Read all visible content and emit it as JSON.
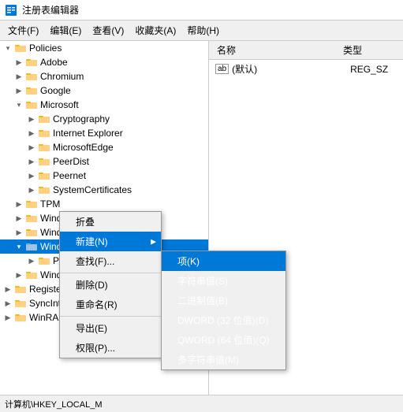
{
  "titleBar": {
    "icon": "registry-editor-icon",
    "title": "注册表编辑器"
  },
  "menuBar": {
    "items": [
      {
        "label": "文件(F)"
      },
      {
        "label": "编辑(E)"
      },
      {
        "label": "查看(V)"
      },
      {
        "label": "收藏夹(A)"
      },
      {
        "label": "帮助(H)"
      }
    ]
  },
  "tree": {
    "items": [
      {
        "id": "policies",
        "label": "Policies",
        "indent": 0,
        "expanded": true,
        "selected": false
      },
      {
        "id": "adobe",
        "label": "Adobe",
        "indent": 1,
        "expanded": false,
        "selected": false
      },
      {
        "id": "chromium",
        "label": "Chromium",
        "indent": 1,
        "expanded": false,
        "selected": false
      },
      {
        "id": "google",
        "label": "Google",
        "indent": 1,
        "expanded": false,
        "selected": false
      },
      {
        "id": "microsoft",
        "label": "Microsoft",
        "indent": 1,
        "expanded": true,
        "selected": false
      },
      {
        "id": "cryptography",
        "label": "Cryptography",
        "indent": 2,
        "expanded": false,
        "selected": false
      },
      {
        "id": "internet-explorer",
        "label": "Internet Explorer",
        "indent": 2,
        "expanded": false,
        "selected": false
      },
      {
        "id": "microsoftedge",
        "label": "MicrosoftEdge",
        "indent": 2,
        "expanded": false,
        "selected": false
      },
      {
        "id": "peerdist",
        "label": "PeerDist",
        "indent": 2,
        "expanded": false,
        "selected": false
      },
      {
        "id": "peernet",
        "label": "Peernet",
        "indent": 2,
        "expanded": false,
        "selected": false
      },
      {
        "id": "systemcertificates",
        "label": "SystemCertificates",
        "indent": 2,
        "expanded": false,
        "selected": false
      },
      {
        "id": "tpm",
        "label": "TPM",
        "indent": 1,
        "expanded": false,
        "selected": false
      },
      {
        "id": "windows",
        "label": "Windows",
        "indent": 1,
        "expanded": false,
        "selected": false
      },
      {
        "id": "windows-advanced-thre",
        "label": "Windows Advanced Thre",
        "indent": 1,
        "expanded": false,
        "selected": false
      },
      {
        "id": "windows-defender",
        "label": "Windows Defender",
        "indent": 1,
        "expanded": true,
        "selected": true
      },
      {
        "id": "polic",
        "label": "Polic",
        "indent": 2,
        "expanded": false,
        "selected": false
      },
      {
        "id": "windowo",
        "label": "Windowo",
        "indent": 1,
        "expanded": false,
        "selected": false
      },
      {
        "id": "registeredap",
        "label": "RegisteredAp",
        "indent": 0,
        "expanded": false,
        "selected": false
      },
      {
        "id": "syncintegratic",
        "label": "SyncIntegratic",
        "indent": 0,
        "expanded": false,
        "selected": false
      },
      {
        "id": "winrar",
        "label": "WinRAR",
        "indent": 0,
        "expanded": false,
        "selected": false
      }
    ]
  },
  "rightPane": {
    "columns": [
      {
        "label": "名称"
      },
      {
        "label": "类型"
      }
    ],
    "entries": [
      {
        "icon": "ab",
        "name": "(默认)",
        "type": "REG_SZ"
      }
    ]
  },
  "contextMenu": {
    "items": [
      {
        "label": "折叠",
        "id": "collapse",
        "hasSubmenu": false
      },
      {
        "label": "新建(N)",
        "id": "new",
        "hasSubmenu": true,
        "highlighted": true
      },
      {
        "label": "查找(F)...",
        "id": "find",
        "hasSubmenu": false
      },
      {
        "label": "删除(D)",
        "id": "delete",
        "hasSubmenu": false
      },
      {
        "label": "重命名(R)",
        "id": "rename",
        "hasSubmenu": false
      },
      {
        "label": "导出(E)",
        "id": "export",
        "hasSubmenu": false
      },
      {
        "label": "权限(P)...",
        "id": "permissions",
        "hasSubmenu": false
      }
    ],
    "submenu": {
      "items": [
        {
          "label": "项(K)",
          "id": "key",
          "highlighted": true
        },
        {
          "label": "字符串值(S)",
          "id": "string-value",
          "highlighted": false
        },
        {
          "label": "二进制值(B)",
          "id": "binary-value",
          "highlighted": false
        },
        {
          "label": "DWORD (32 位值)(D)",
          "id": "dword-value",
          "highlighted": false
        },
        {
          "label": "QWORD (64 位值)(Q)",
          "id": "qword-value",
          "highlighted": false
        },
        {
          "label": "多字符串值(M)",
          "id": "multi-string-value",
          "highlighted": false
        }
      ]
    }
  },
  "statusBar": {
    "text": "计算机\\HKEY_LOCAL_M"
  }
}
